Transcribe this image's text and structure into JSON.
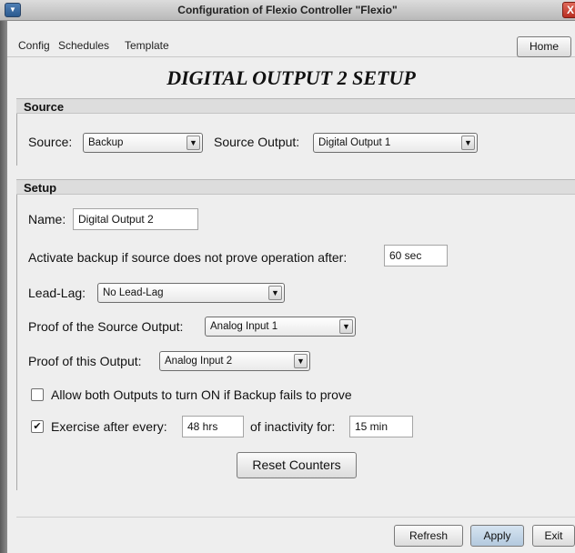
{
  "window": {
    "title": "Configuration of Flexio Controller \"Flexio\"",
    "close_glyph": "X",
    "system_glyph": "▼"
  },
  "menu": {
    "items": [
      "Config",
      "Schedules",
      "Template"
    ],
    "home_label": "Home"
  },
  "page": {
    "title": "DIGITAL OUTPUT 2 SETUP"
  },
  "source": {
    "header": "Source",
    "source_label": "Source:",
    "source_value": "Backup",
    "source_output_label": "Source Output:",
    "source_output_value": "Digital Output 1"
  },
  "setup": {
    "header": "Setup",
    "name_label": "Name:",
    "name_value": "Digital Output 2",
    "activate_label": "Activate backup if source does not prove operation after:",
    "activate_value": "60 sec",
    "leadlag_label": "Lead-Lag:",
    "leadlag_value": "No Lead-Lag",
    "proof_source_label": "Proof of the Source Output:",
    "proof_source_value": "Analog Input 1",
    "proof_this_label": "Proof of this Output:",
    "proof_this_value": "Analog Input 2",
    "allow_both_label": "Allow both Outputs to turn ON if Backup fails to prove",
    "allow_both_checked": false,
    "exercise_label": "Exercise after every:",
    "exercise_checked": true,
    "exercise_value": "48 hrs",
    "inactivity_label": "of inactivity for:",
    "inactivity_value": "15 min",
    "check_glyph": "✔",
    "reset_label": "Reset Counters"
  },
  "icons": {
    "dropdown": "dropdown-arrow-icon"
  },
  "footer": {
    "refresh_label": "Refresh",
    "apply_label": "Apply",
    "exit_label": "Exit"
  }
}
